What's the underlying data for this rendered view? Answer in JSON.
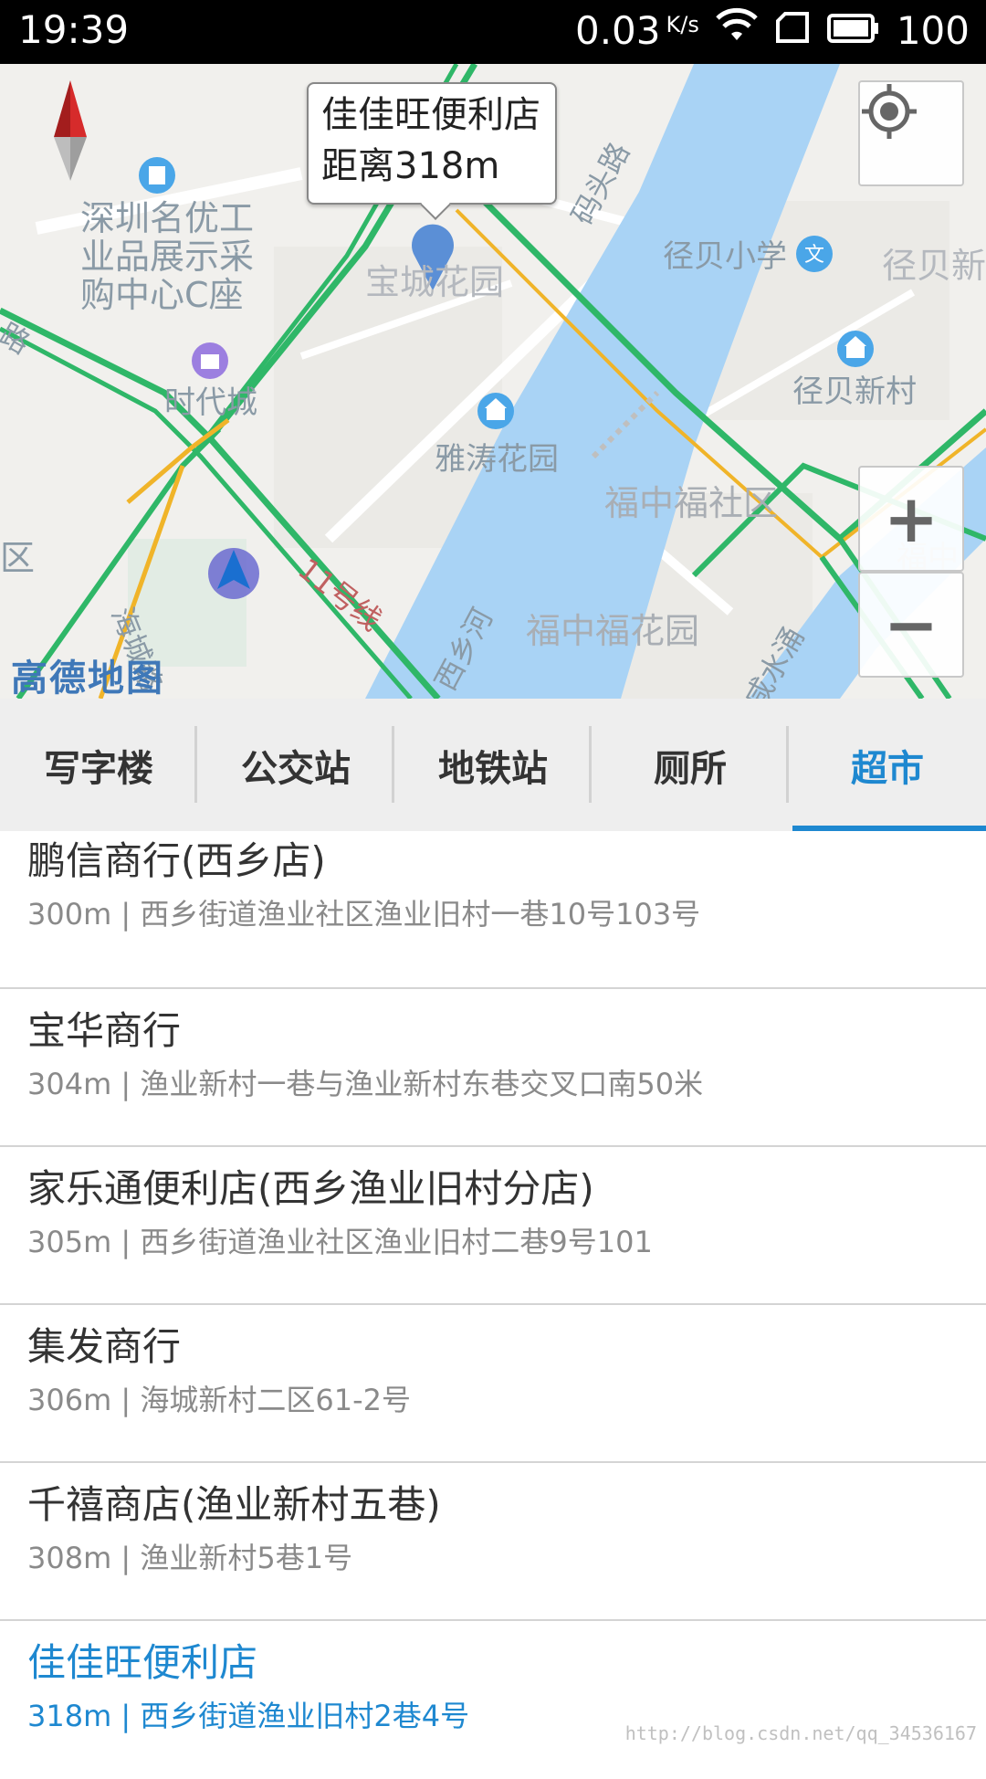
{
  "status_bar": {
    "time": "19:39",
    "net_speed": "0.03",
    "net_unit": "K/s",
    "battery": "100"
  },
  "map": {
    "callout": {
      "name": "佳佳旺便利店",
      "distance": "距离318m"
    },
    "labels": [
      {
        "text": "深圳名优工",
        "key": "l1"
      },
      {
        "text": "业品展示采",
        "key": "l2"
      },
      {
        "text": "购中心C座",
        "key": "l3"
      },
      {
        "text": "时代城",
        "key": "l4"
      },
      {
        "text": "宝城花园",
        "key": "l5"
      },
      {
        "text": "雅涛花园",
        "key": "l6"
      },
      {
        "text": "径贝小学",
        "key": "l7"
      },
      {
        "text": "径贝新",
        "key": "l8"
      },
      {
        "text": "径贝新村",
        "key": "l9"
      },
      {
        "text": "福中福社区",
        "key": "l10"
      },
      {
        "text": "福中福花园",
        "key": "l11"
      },
      {
        "text": "福中",
        "key": "l12"
      },
      {
        "text": "区",
        "key": "l13"
      },
      {
        "text": "码头路",
        "key": "l14"
      },
      {
        "text": "海城路",
        "key": "l15"
      },
      {
        "text": "11号线",
        "key": "l16"
      },
      {
        "text": "西乡河",
        "key": "l17"
      },
      {
        "text": "咸水涌",
        "key": "l18"
      },
      {
        "text": "路",
        "key": "l19"
      }
    ],
    "logo": "高德地图",
    "zoom_in": "+",
    "zoom_out": "−",
    "colors": {
      "road_green": "#2fb768",
      "road_yellow": "#f0b429",
      "river": "#a9d3f5",
      "marker": "#5b8fd6"
    }
  },
  "tabs": [
    {
      "label": "写字楼"
    },
    {
      "label": "公交站"
    },
    {
      "label": "地铁站"
    },
    {
      "label": "厕所"
    },
    {
      "label": "超市"
    }
  ],
  "active_tab": "超市",
  "list": [
    {
      "name": "鹏信商行(西乡店)",
      "addr": "300m | 西乡街道渔业社区渔业旧村一巷10号103号"
    },
    {
      "name": "宝华商行",
      "addr": "304m | 渔业新村一巷与渔业新村东巷交叉口南50米"
    },
    {
      "name": "家乐通便利店(西乡渔业旧村分店)",
      "addr": "305m | 西乡街道渔业社区渔业旧村二巷9号101"
    },
    {
      "name": "集发商行",
      "addr": "306m | 海城新村二区61-2号"
    },
    {
      "name": "千禧商店(渔业新村五巷)",
      "addr": "308m | 渔业新村5巷1号"
    },
    {
      "name": "佳佳旺便利店",
      "addr": "318m | 西乡街道渔业旧村2巷4号"
    }
  ],
  "watermark": "http://blog.csdn.net/qq_34536167"
}
